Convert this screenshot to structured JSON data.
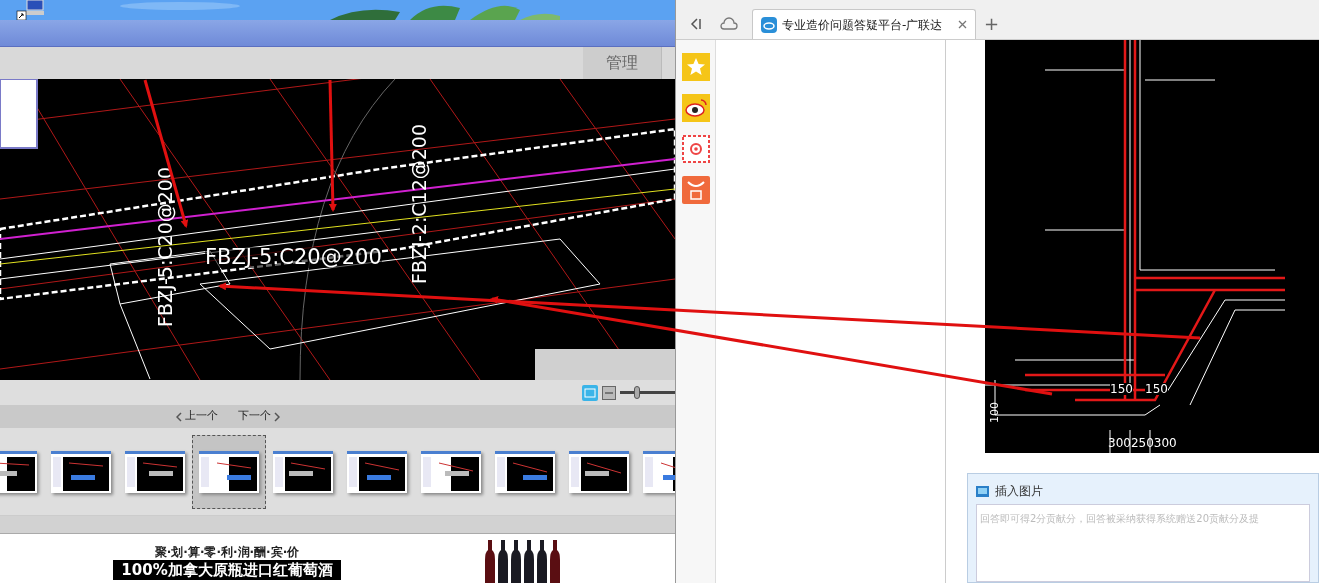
{
  "viewer": {
    "manage_button": "管理",
    "cad_labels": [
      {
        "text": "FBZJ-5:C20@200",
        "kind": "horizontal"
      },
      {
        "text": "FBZJ-5:C20@200",
        "kind": "vertical"
      },
      {
        "text": "FBZJ-2:C12@200",
        "kind": "vertical"
      }
    ],
    "zoom_slider": {
      "level": 0.3
    },
    "nav": {
      "prev": "上一个",
      "next": "下一个"
    },
    "thumbnails": [
      {
        "selected": false
      },
      {
        "selected": false
      },
      {
        "selected": false
      },
      {
        "selected": true
      },
      {
        "selected": false
      },
      {
        "selected": false
      },
      {
        "selected": false
      },
      {
        "selected": false
      },
      {
        "selected": false
      },
      {
        "selected": false
      }
    ]
  },
  "ad": {
    "tagline": "聚·划·算·零·利·润·酬·宾·价",
    "headline": "100%加拿大原瓶进口红葡萄酒"
  },
  "browser": {
    "tabs": [
      {
        "title": "专业造价问题答疑平台-广联达",
        "selected": true
      }
    ],
    "new_tab": "+",
    "drawing_labels": [
      "150",
      "150",
      "100",
      "300250300"
    ],
    "insert_image": "插入图片",
    "answer_placeholder": "回答即可得2分贡献分，回答被采纳获得系统赠送20贡献分及提"
  }
}
